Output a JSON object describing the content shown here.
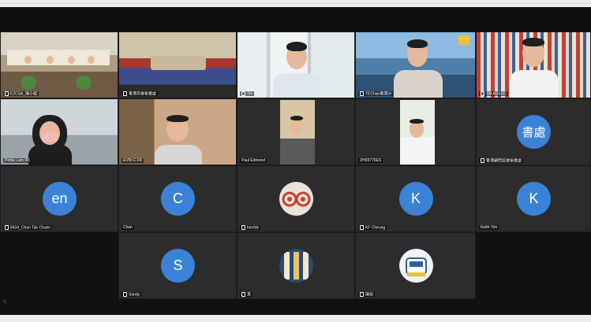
{
  "participants": [
    {
      "name": "E2CSA_陳小姐",
      "kind": "video",
      "scene": "room",
      "audio": true
    },
    {
      "name": "香港商會秘書處",
      "kind": "video",
      "scene": "room",
      "audio": true
    },
    {
      "name": "TH",
      "kind": "video",
      "scene": "window",
      "audio": true
    },
    {
      "name": "TEChan香港分",
      "kind": "video",
      "scene": "city",
      "audio": true
    },
    {
      "name": "SM ASSOC",
      "kind": "video",
      "scene": "shelf",
      "audio": true
    },
    {
      "name": "Pettie Lam (R)",
      "kind": "video",
      "scene": "office",
      "audio": false
    },
    {
      "name": "EVM-C.FR",
      "kind": "video",
      "scene": "office",
      "audio": false
    },
    {
      "name": "Paul Edmond",
      "kind": "video",
      "scene": "inset",
      "audio": false
    },
    {
      "name": "ZH09776ES",
      "kind": "video",
      "scene": "inset",
      "audio": false
    },
    {
      "name": "香港顧問協會秘書處",
      "kind": "avatar",
      "initial": "書處",
      "audio": true
    },
    {
      "name": "8434_Chan Tak Chuen",
      "kind": "avatar",
      "initial": "en",
      "audio": true
    },
    {
      "name": "Chan",
      "kind": "avatar",
      "initial": "C",
      "audio": false
    },
    {
      "name": "benfok",
      "kind": "photo",
      "audio": true
    },
    {
      "name": "KF Cheung",
      "kind": "avatar",
      "initial": "K",
      "audio": true
    },
    {
      "name": "Keith Yim",
      "kind": "avatar",
      "initial": "K",
      "audio": false
    },
    {
      "name": "Sandy",
      "kind": "avatar",
      "initial": "S",
      "audio": true
    },
    {
      "name": "其",
      "kind": "photo",
      "audio": true
    },
    {
      "name": "陳伯",
      "kind": "photo",
      "audio": true
    }
  ],
  "colors": {
    "avatar_bg": "#3b82d6",
    "tile_bg": "#2c2c2c",
    "screen_bg": "#111111"
  }
}
